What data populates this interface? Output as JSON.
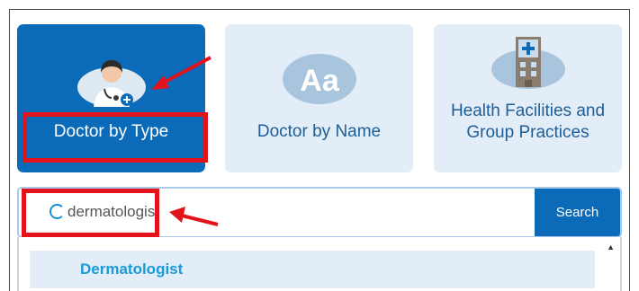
{
  "tiles": [
    {
      "label": "Doctor by Type",
      "icon": "doctor-icon",
      "selected": true
    },
    {
      "label": "Doctor by Name",
      "icon": "text-aa-icon",
      "selected": false
    },
    {
      "label": "Health Facilities and Group Practices",
      "icon": "hospital-building-icon",
      "selected": false
    }
  ],
  "search": {
    "value": "dermatologist",
    "button_label": "Search",
    "loading_icon": "spinner-icon"
  },
  "suggestions": [
    {
      "label": "Dermatologist"
    }
  ],
  "colors": {
    "primary": "#0c6bb8",
    "tile_inactive": "#e2edf7",
    "annotation": "#e3131b",
    "suggestion_text": "#1a9ad6"
  }
}
